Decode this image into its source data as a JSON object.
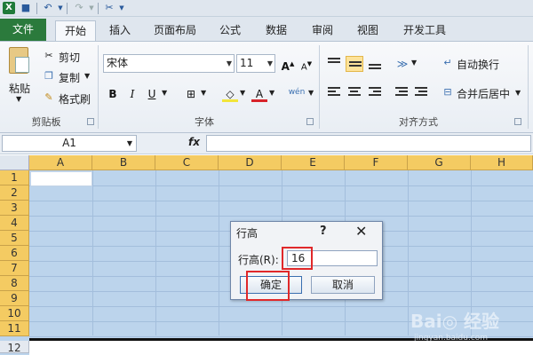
{
  "qat": {
    "icons": [
      "excel-logo-icon",
      "save-icon",
      "undo-icon",
      "redo-icon",
      "customize-icon"
    ]
  },
  "tabs": {
    "file": "文件",
    "home": "开始",
    "insert": "插入",
    "page_layout": "页面布局",
    "formulas": "公式",
    "data": "数据",
    "review": "审阅",
    "view": "视图",
    "developer": "开发工具"
  },
  "clipboard": {
    "paste": "粘贴",
    "cut": "剪切",
    "copy": "复制",
    "format_painter": "格式刷",
    "group": "剪贴板"
  },
  "font": {
    "name": "宋体",
    "size": "11",
    "bold": "B",
    "italic": "I",
    "underline": "U",
    "phonetic": "wén",
    "group": "字体"
  },
  "alignment": {
    "wrap": "自动换行",
    "merge": "合并后居中",
    "group": "对齐方式"
  },
  "formula_bar": {
    "cell_ref": "A1",
    "fx": "fx"
  },
  "grid": {
    "columns": [
      "A",
      "B",
      "C",
      "D",
      "E",
      "F",
      "G",
      "H"
    ],
    "rows": [
      "1",
      "2",
      "3",
      "4",
      "5",
      "6",
      "7",
      "8",
      "9",
      "10",
      "11",
      "12"
    ]
  },
  "dialog": {
    "title": "行高",
    "help": "?",
    "close": "✕",
    "label": "行高(R):",
    "value": "16",
    "ok": "确定",
    "cancel": "取消"
  },
  "watermark": {
    "text": "Bai◎ 经验",
    "url": "jingyan.baidu.com"
  },
  "colors": {
    "selection": "#bcd4ec",
    "header_highlight": "#f4cb62",
    "file_tab": "#2b7a3c",
    "annotation": "#e0282a"
  }
}
